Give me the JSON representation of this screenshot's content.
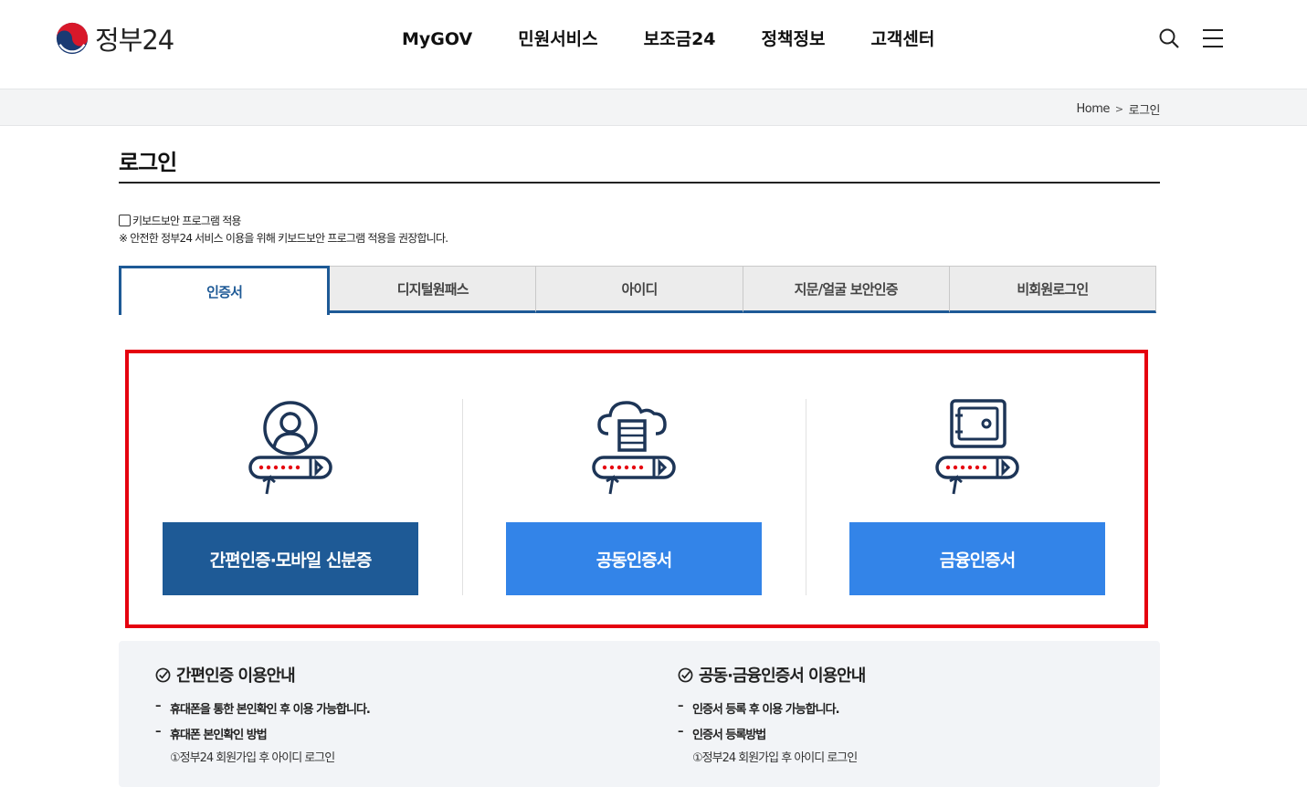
{
  "header": {
    "logo_text": "정부24",
    "nav": [
      "MyGOV",
      "민원서비스",
      "보조금24",
      "정책정보",
      "고객센터"
    ],
    "icons": [
      "search-icon",
      "menu-icon"
    ]
  },
  "breadcrumb": {
    "home": "Home",
    "current": "로그인"
  },
  "page": {
    "title": "로그인",
    "keyboard_security_label": "키보드보안 프로그램 적용",
    "keyboard_security_checked": false,
    "keyboard_security_note": "※ 안전한 정부24 서비스 이용을 위해 키보드보안 프로그램 적용을 권장합니다."
  },
  "tabs": [
    {
      "label": "인증서",
      "active": true
    },
    {
      "label": "디지털원패스",
      "active": false
    },
    {
      "label": "아이디",
      "active": false
    },
    {
      "label": "지문/얼굴 보안인증",
      "active": false
    },
    {
      "label": "비회원로그인",
      "active": false
    }
  ],
  "login_methods": [
    {
      "label": "간편인증·모바일 신분증",
      "icon": "user-login-icon",
      "color": "#1e5a96"
    },
    {
      "label": "공동인증서",
      "icon": "cloud-server-login-icon",
      "color": "#3384e8"
    },
    {
      "label": "금융인증서",
      "icon": "safe-login-icon",
      "color": "#3384e8"
    }
  ],
  "info": {
    "simple": {
      "title": "간편인증 이용안내",
      "items": [
        "휴대폰을 통한 본인확인 후 이용 가능합니다.",
        "휴대폰 본인확인 방법"
      ],
      "sub": "①정부24 회원가입 후 아이디 로그인"
    },
    "cert": {
      "title": "공동·금융인증서 이용안내",
      "items": [
        "인증서 등록 후 이용 가능합니다.",
        "인증서 등록방법"
      ],
      "sub": "①정부24 회원가입 후 아이디 로그인"
    }
  }
}
